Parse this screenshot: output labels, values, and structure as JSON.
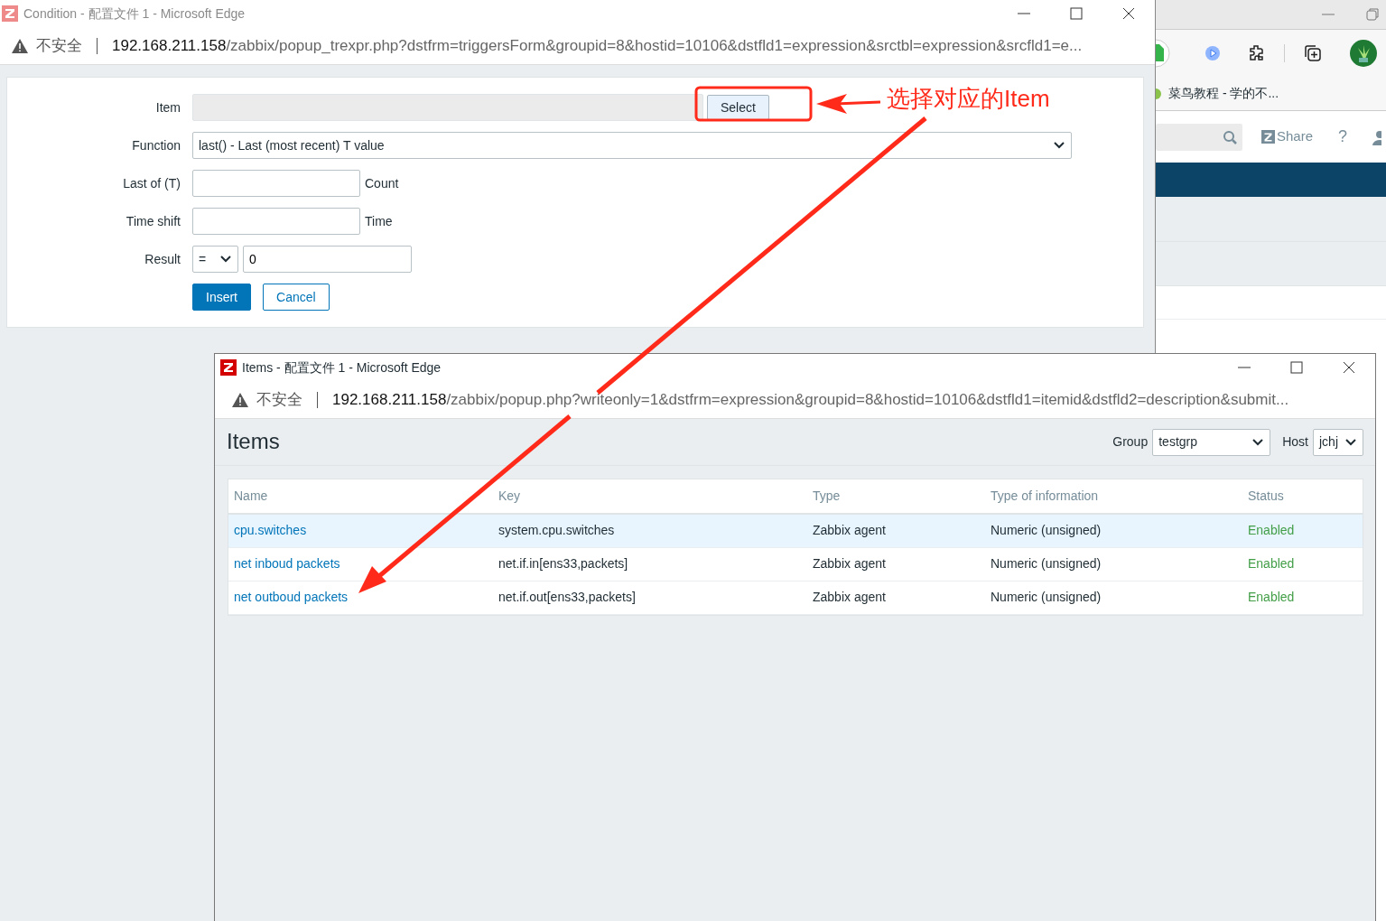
{
  "background_window": {
    "bookmark": "菜鸟教程 - 学的不...",
    "share_label": "Share",
    "help_label": "?"
  },
  "condition_window": {
    "title": "Condition - 配置文件 1 - Microsoft Edge",
    "security_label": "不安全",
    "url_host": "192.168.211.158",
    "url_path": "/zabbix/popup_trexpr.php?dstfrm=triggersForm&groupid=8&hostid=10106&dstfld1=expression&srctbl=expression&srcfld1=e...",
    "form": {
      "item_label": "Item",
      "select_button": "Select",
      "function_label": "Function",
      "function_value": "last() - Last (most recent) T value",
      "last_of_label": "Last of (T)",
      "last_of_unit": "Count",
      "time_shift_label": "Time shift",
      "time_shift_unit": "Time",
      "result_label": "Result",
      "result_operator": "=",
      "result_value": "0",
      "buttons": [
        {
          "label": "Insert",
          "kind": "primary"
        },
        {
          "label": "Cancel",
          "kind": "outline"
        }
      ]
    }
  },
  "items_window": {
    "title": "Items - 配置文件 1 - Microsoft Edge",
    "security_label": "不安全",
    "url_host": "192.168.211.158",
    "url_path": "/zabbix/popup.php?writeonly=1&dstfrm=expression&groupid=8&hostid=10106&dstfld1=itemid&dstfld2=description&submit...",
    "heading": "Items",
    "group_label": "Group",
    "group_value": "testgrp",
    "host_label": "Host",
    "host_value": "jchj",
    "table": {
      "columns": [
        "Name",
        "Key",
        "Type",
        "Type of information",
        "Status"
      ],
      "rows": [
        {
          "name": "cpu.switches",
          "key": "system.cpu.switches",
          "type": "Zabbix agent",
          "type_of_information": "Numeric (unsigned)",
          "status": "Enabled",
          "selected": true
        },
        {
          "name": "net inboud packets",
          "key": "net.if.in[ens33,packets]",
          "type": "Zabbix agent",
          "type_of_information": "Numeric (unsigned)",
          "status": "Enabled",
          "selected": false
        },
        {
          "name": "net outboud packets",
          "key": "net.if.out[ens33,packets]",
          "type": "Zabbix agent",
          "type_of_information": "Numeric (unsigned)",
          "status": "Enabled",
          "selected": false
        }
      ]
    }
  },
  "annotation": {
    "callout": "选择对应的Item"
  }
}
